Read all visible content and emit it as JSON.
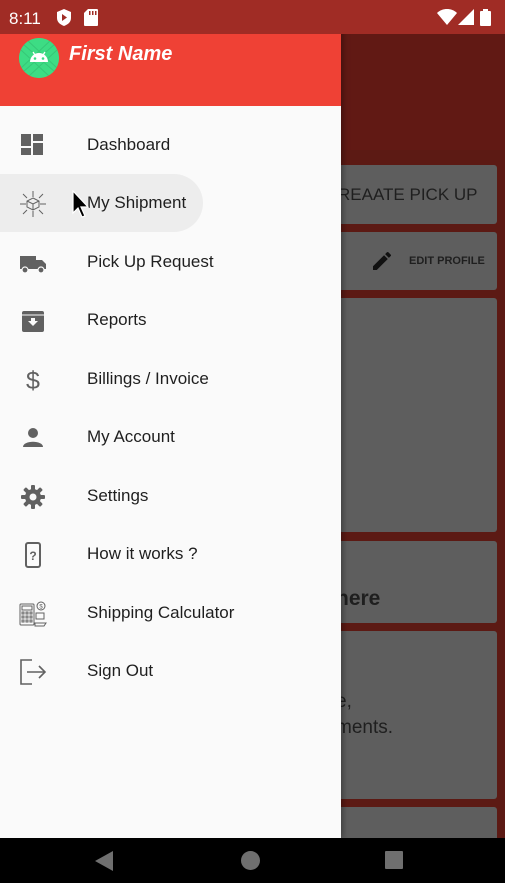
{
  "status_bar": {
    "time": "8:11"
  },
  "drawer": {
    "user_name": "First Name",
    "items": [
      {
        "label": "Dashboard",
        "icon": "dashboard-icon"
      },
      {
        "label": "My Shipment",
        "icon": "shipment-box-icon",
        "active": true
      },
      {
        "label": "Pick Up Request",
        "icon": "truck-icon"
      },
      {
        "label": "Reports",
        "icon": "archive-icon"
      },
      {
        "label": "Billings / Invoice",
        "icon": "dollar-icon"
      },
      {
        "label": "My Account",
        "icon": "person-icon"
      },
      {
        "label": "Settings",
        "icon": "gear-icon"
      },
      {
        "label": "How it works ?",
        "icon": "help-phone-icon"
      },
      {
        "label": "Shipping Calculator",
        "icon": "calculator-icon"
      },
      {
        "label": "Sign Out",
        "icon": "sign-out-icon"
      }
    ]
  },
  "background": {
    "create_pickup": "REAATE PICK UP",
    "edit_profile": "EDIT PROFILE",
    "partial_text_1": "here",
    "partial_text_2": "e,",
    "partial_text_3": "ments."
  },
  "colors": {
    "accent": "#ef4135",
    "status_bar": "#a02c25",
    "drawer_bg": "#fafafa",
    "icon": "#616161"
  }
}
